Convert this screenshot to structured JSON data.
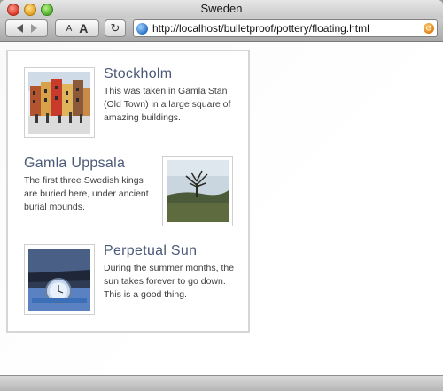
{
  "window": {
    "title": "Sweden"
  },
  "toolbar": {
    "text_size_small": "A",
    "text_size_large": "A",
    "reload_glyph": "↻",
    "url": "http://localhost/bulletproof/pottery/floating.html"
  },
  "items": [
    {
      "title": "Stockholm",
      "text": "This was taken in Gamla Stan (Old Town) in a large square of amazing buildings.",
      "photo_icon": "stockholm-square-photo"
    },
    {
      "title": "Gamla Uppsala",
      "text": "The first three Swedish kings are buried here, under ancient burial mounds.",
      "photo_icon": "tree-field-photo"
    },
    {
      "title": "Perpetual Sun",
      "text": "During the summer months, the sun takes forever to go down. This is a good thing.",
      "photo_icon": "wristwatch-photo"
    }
  ],
  "colors": {
    "heading": "#4a5a76",
    "body_text": "#3d3d3d",
    "panel_border": "#d6d6d6"
  }
}
